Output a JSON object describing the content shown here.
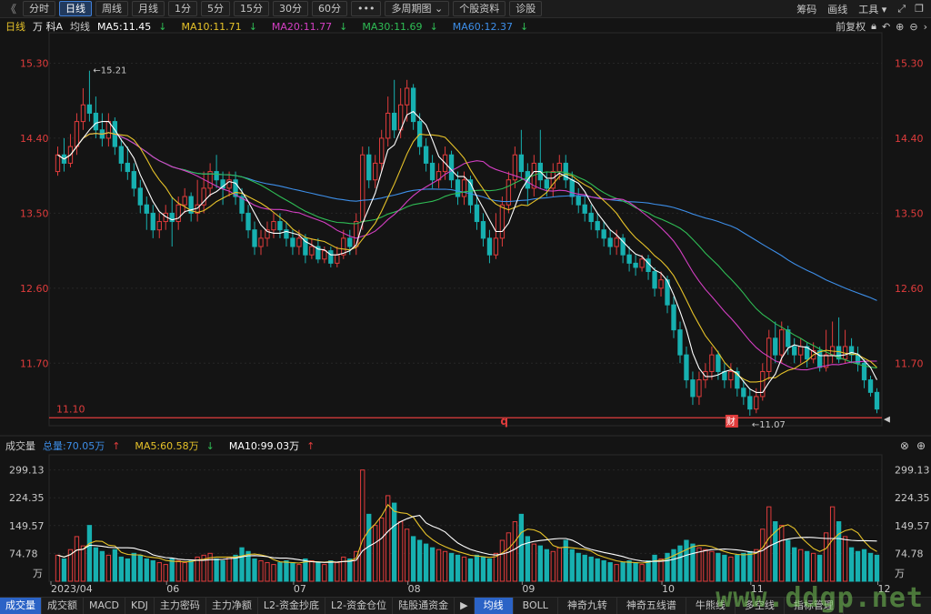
{
  "toolbar": {
    "back": "《",
    "periods": [
      "分时",
      "日线",
      "周线",
      "月线",
      "1分",
      "5分",
      "15分",
      "30分",
      "60分",
      "•••",
      "多周期图",
      "个股资料",
      "诊股"
    ],
    "active_period": "日线",
    "right_items": [
      "筹码",
      "画线",
      "工具"
    ]
  },
  "main_legend": {
    "period": "日线",
    "stock": "万 科A",
    "ma_label": "均线",
    "ma5": "MA5:11.45",
    "ma10": "MA10:11.71",
    "ma20": "MA20:11.77",
    "ma30": "MA30:11.69",
    "ma60": "MA60:12.37",
    "adjust": "前复权"
  },
  "vol_legend": {
    "label": "成交量",
    "total": "总量:70.05万",
    "ma5": "MA5:60.58万",
    "ma10": "MA10:99.03万"
  },
  "colors": {
    "up": "#e03c3c",
    "down": "#17b0b0",
    "ma5": "#ffffff",
    "ma10": "#e6c229",
    "ma20": "#d43fc3",
    "ma30": "#2fbd55",
    "ma60": "#3d8ee8"
  },
  "chart_data": {
    "type": "candlestick",
    "price_ticks": [
      "15.30",
      "14.40",
      "13.50",
      "12.60",
      "11.70"
    ],
    "price_ylim": [
      10.95,
      15.6
    ],
    "volume_ticks": [
      "299.13",
      "224.35",
      "149.57",
      "74.78"
    ],
    "volume_unit": "万",
    "volume_ylim": [
      0,
      330
    ],
    "x_labels": [
      "2023/04",
      "06",
      "07",
      "08",
      "09",
      "10",
      "11",
      "12"
    ],
    "high_annotation": "15.21",
    "low_annotation": "11.07",
    "hline_label": "11.10",
    "hline_value": 11.1,
    "markers": [
      "q",
      "财"
    ],
    "candles": [
      {
        "o": 14.0,
        "c": 14.2,
        "h": 14.3,
        "l": 13.95,
        "v": 70
      },
      {
        "o": 14.2,
        "c": 14.1,
        "h": 14.4,
        "l": 14.0,
        "v": 60
      },
      {
        "o": 14.1,
        "c": 14.3,
        "h": 14.45,
        "l": 14.05,
        "v": 85
      },
      {
        "o": 14.3,
        "c": 14.6,
        "h": 14.7,
        "l": 14.2,
        "v": 120
      },
      {
        "o": 14.6,
        "c": 14.8,
        "h": 15.0,
        "l": 14.5,
        "v": 95
      },
      {
        "o": 14.8,
        "c": 14.7,
        "h": 15.21,
        "l": 14.6,
        "v": 150
      },
      {
        "o": 14.7,
        "c": 14.5,
        "h": 14.9,
        "l": 14.4,
        "v": 90
      },
      {
        "o": 14.5,
        "c": 14.4,
        "h": 14.7,
        "l": 14.3,
        "v": 80
      },
      {
        "o": 14.4,
        "c": 14.6,
        "h": 14.7,
        "l": 14.3,
        "v": 70
      },
      {
        "o": 14.6,
        "c": 14.3,
        "h": 14.65,
        "l": 14.2,
        "v": 85
      },
      {
        "o": 14.3,
        "c": 14.1,
        "h": 14.4,
        "l": 14.0,
        "v": 65
      },
      {
        "o": 14.1,
        "c": 14.0,
        "h": 14.3,
        "l": 13.9,
        "v": 60
      },
      {
        "o": 14.0,
        "c": 13.8,
        "h": 14.1,
        "l": 13.7,
        "v": 75
      },
      {
        "o": 13.8,
        "c": 13.6,
        "h": 13.9,
        "l": 13.5,
        "v": 70
      },
      {
        "o": 13.6,
        "c": 13.5,
        "h": 13.7,
        "l": 13.3,
        "v": 60
      },
      {
        "o": 13.5,
        "c": 13.3,
        "h": 13.6,
        "l": 13.2,
        "v": 55
      },
      {
        "o": 13.3,
        "c": 13.4,
        "h": 13.5,
        "l": 13.2,
        "v": 50
      },
      {
        "o": 13.4,
        "c": 13.5,
        "h": 13.6,
        "l": 13.3,
        "v": 45
      },
      {
        "o": 13.5,
        "c": 13.4,
        "h": 13.7,
        "l": 13.1,
        "v": 60
      },
      {
        "o": 13.4,
        "c": 13.6,
        "h": 13.7,
        "l": 13.3,
        "v": 55
      },
      {
        "o": 13.6,
        "c": 13.7,
        "h": 13.8,
        "l": 13.5,
        "v": 50
      },
      {
        "o": 13.7,
        "c": 13.5,
        "h": 13.75,
        "l": 13.4,
        "v": 55
      },
      {
        "o": 13.5,
        "c": 13.6,
        "h": 13.9,
        "l": 13.4,
        "v": 65
      },
      {
        "o": 13.6,
        "c": 13.8,
        "h": 14.0,
        "l": 13.5,
        "v": 70
      },
      {
        "o": 13.8,
        "c": 14.0,
        "h": 14.1,
        "l": 13.7,
        "v": 75
      },
      {
        "o": 14.0,
        "c": 13.9,
        "h": 14.2,
        "l": 13.8,
        "v": 60
      },
      {
        "o": 13.9,
        "c": 13.8,
        "h": 14.0,
        "l": 13.6,
        "v": 55
      },
      {
        "o": 13.8,
        "c": 13.9,
        "h": 14.0,
        "l": 13.7,
        "v": 65
      },
      {
        "o": 13.9,
        "c": 13.7,
        "h": 14.0,
        "l": 13.6,
        "v": 70
      },
      {
        "o": 13.7,
        "c": 13.5,
        "h": 13.8,
        "l": 13.4,
        "v": 90
      },
      {
        "o": 13.5,
        "c": 13.3,
        "h": 13.6,
        "l": 13.2,
        "v": 80
      },
      {
        "o": 13.3,
        "c": 13.1,
        "h": 13.4,
        "l": 13.0,
        "v": 60
      },
      {
        "o": 13.1,
        "c": 13.2,
        "h": 13.3,
        "l": 13.0,
        "v": 55
      },
      {
        "o": 13.2,
        "c": 13.3,
        "h": 13.4,
        "l": 13.1,
        "v": 50
      },
      {
        "o": 13.3,
        "c": 13.4,
        "h": 13.5,
        "l": 13.2,
        "v": 45
      },
      {
        "o": 13.4,
        "c": 13.3,
        "h": 13.5,
        "l": 13.2,
        "v": 50
      },
      {
        "o": 13.3,
        "c": 13.2,
        "h": 13.4,
        "l": 13.1,
        "v": 55
      },
      {
        "o": 13.2,
        "c": 13.1,
        "h": 13.3,
        "l": 13.0,
        "v": 50
      },
      {
        "o": 13.1,
        "c": 13.2,
        "h": 13.3,
        "l": 13.0,
        "v": 45
      },
      {
        "o": 13.2,
        "c": 13.0,
        "h": 13.25,
        "l": 12.9,
        "v": 60
      },
      {
        "o": 13.0,
        "c": 13.1,
        "h": 13.2,
        "l": 12.95,
        "v": 55
      },
      {
        "o": 13.1,
        "c": 12.95,
        "h": 13.2,
        "l": 12.9,
        "v": 50
      },
      {
        "o": 12.95,
        "c": 13.05,
        "h": 13.1,
        "l": 12.9,
        "v": 45
      },
      {
        "o": 13.05,
        "c": 12.9,
        "h": 13.1,
        "l": 12.85,
        "v": 55
      },
      {
        "o": 12.9,
        "c": 13.0,
        "h": 13.1,
        "l": 12.85,
        "v": 50
      },
      {
        "o": 13.0,
        "c": 13.2,
        "h": 13.3,
        "l": 12.95,
        "v": 65
      },
      {
        "o": 13.2,
        "c": 13.1,
        "h": 13.3,
        "l": 13.0,
        "v": 60
      },
      {
        "o": 13.1,
        "c": 13.4,
        "h": 13.5,
        "l": 13.0,
        "v": 80
      },
      {
        "o": 13.4,
        "c": 14.2,
        "h": 14.3,
        "l": 13.3,
        "v": 299
      },
      {
        "o": 14.2,
        "c": 13.9,
        "h": 14.3,
        "l": 13.8,
        "v": 180
      },
      {
        "o": 13.9,
        "c": 14.1,
        "h": 14.2,
        "l": 13.8,
        "v": 150
      },
      {
        "o": 14.1,
        "c": 14.4,
        "h": 14.5,
        "l": 14.0,
        "v": 170
      },
      {
        "o": 14.4,
        "c": 14.7,
        "h": 14.9,
        "l": 14.3,
        "v": 230
      },
      {
        "o": 14.7,
        "c": 14.5,
        "h": 15.1,
        "l": 14.4,
        "v": 210
      },
      {
        "o": 14.5,
        "c": 14.8,
        "h": 15.0,
        "l": 14.4,
        "v": 160
      },
      {
        "o": 14.8,
        "c": 15.0,
        "h": 15.1,
        "l": 14.6,
        "v": 140
      },
      {
        "o": 15.0,
        "c": 14.6,
        "h": 15.05,
        "l": 14.5,
        "v": 120
      },
      {
        "o": 14.6,
        "c": 14.3,
        "h": 14.7,
        "l": 14.2,
        "v": 110
      },
      {
        "o": 14.3,
        "c": 14.1,
        "h": 14.4,
        "l": 14.0,
        "v": 100
      },
      {
        "o": 14.1,
        "c": 13.9,
        "h": 14.2,
        "l": 13.8,
        "v": 90
      },
      {
        "o": 13.9,
        "c": 14.0,
        "h": 14.1,
        "l": 13.8,
        "v": 85
      },
      {
        "o": 14.0,
        "c": 14.2,
        "h": 14.3,
        "l": 13.9,
        "v": 80
      },
      {
        "o": 14.2,
        "c": 13.9,
        "h": 14.25,
        "l": 13.8,
        "v": 75
      },
      {
        "o": 13.9,
        "c": 13.7,
        "h": 14.0,
        "l": 13.6,
        "v": 70
      },
      {
        "o": 13.7,
        "c": 13.9,
        "h": 14.0,
        "l": 13.6,
        "v": 65
      },
      {
        "o": 13.9,
        "c": 13.6,
        "h": 13.95,
        "l": 13.5,
        "v": 60
      },
      {
        "o": 13.6,
        "c": 13.4,
        "h": 13.7,
        "l": 13.3,
        "v": 70
      },
      {
        "o": 13.4,
        "c": 13.2,
        "h": 13.5,
        "l": 13.1,
        "v": 65
      },
      {
        "o": 13.2,
        "c": 13.0,
        "h": 13.3,
        "l": 12.9,
        "v": 60
      },
      {
        "o": 13.0,
        "c": 13.2,
        "h": 13.5,
        "l": 12.95,
        "v": 75
      },
      {
        "o": 13.2,
        "c": 13.6,
        "h": 13.7,
        "l": 13.1,
        "v": 110
      },
      {
        "o": 13.6,
        "c": 13.9,
        "h": 14.0,
        "l": 13.5,
        "v": 130
      },
      {
        "o": 13.9,
        "c": 14.2,
        "h": 14.3,
        "l": 13.8,
        "v": 160
      },
      {
        "o": 14.2,
        "c": 14.0,
        "h": 14.5,
        "l": 13.9,
        "v": 180
      },
      {
        "o": 14.0,
        "c": 13.8,
        "h": 14.1,
        "l": 13.6,
        "v": 120
      },
      {
        "o": 13.8,
        "c": 14.1,
        "h": 14.2,
        "l": 13.7,
        "v": 100
      },
      {
        "o": 14.1,
        "c": 13.9,
        "h": 14.5,
        "l": 13.8,
        "v": 95
      },
      {
        "o": 13.9,
        "c": 13.8,
        "h": 14.0,
        "l": 13.7,
        "v": 85
      },
      {
        "o": 13.8,
        "c": 14.0,
        "h": 14.1,
        "l": 13.7,
        "v": 80
      },
      {
        "o": 14.0,
        "c": 14.1,
        "h": 14.2,
        "l": 13.9,
        "v": 90
      },
      {
        "o": 14.1,
        "c": 13.9,
        "h": 14.2,
        "l": 13.8,
        "v": 110
      },
      {
        "o": 13.9,
        "c": 13.7,
        "h": 14.0,
        "l": 13.6,
        "v": 85
      },
      {
        "o": 13.7,
        "c": 13.6,
        "h": 13.8,
        "l": 13.5,
        "v": 75
      },
      {
        "o": 13.6,
        "c": 13.5,
        "h": 13.7,
        "l": 13.4,
        "v": 70
      },
      {
        "o": 13.5,
        "c": 13.4,
        "h": 13.6,
        "l": 13.3,
        "v": 65
      },
      {
        "o": 13.4,
        "c": 13.3,
        "h": 13.5,
        "l": 13.2,
        "v": 60
      },
      {
        "o": 13.3,
        "c": 13.2,
        "h": 13.4,
        "l": 13.1,
        "v": 55
      },
      {
        "o": 13.2,
        "c": 13.1,
        "h": 13.3,
        "l": 13.0,
        "v": 50
      },
      {
        "o": 13.1,
        "c": 13.2,
        "h": 13.3,
        "l": 13.0,
        "v": 45
      },
      {
        "o": 13.2,
        "c": 13.0,
        "h": 13.25,
        "l": 12.9,
        "v": 50
      },
      {
        "o": 13.0,
        "c": 12.9,
        "h": 13.1,
        "l": 12.8,
        "v": 55
      },
      {
        "o": 12.9,
        "c": 12.85,
        "h": 13.0,
        "l": 12.75,
        "v": 50
      },
      {
        "o": 12.85,
        "c": 12.95,
        "h": 13.0,
        "l": 12.8,
        "v": 45
      },
      {
        "o": 12.95,
        "c": 12.8,
        "h": 13.0,
        "l": 12.7,
        "v": 55
      },
      {
        "o": 12.8,
        "c": 12.6,
        "h": 12.85,
        "l": 12.5,
        "v": 70
      },
      {
        "o": 12.6,
        "c": 12.7,
        "h": 12.8,
        "l": 12.5,
        "v": 60
      },
      {
        "o": 12.7,
        "c": 12.4,
        "h": 12.75,
        "l": 12.3,
        "v": 75
      },
      {
        "o": 12.4,
        "c": 12.1,
        "h": 12.5,
        "l": 12.0,
        "v": 85
      },
      {
        "o": 12.1,
        "c": 11.8,
        "h": 12.2,
        "l": 11.7,
        "v": 95
      },
      {
        "o": 11.8,
        "c": 11.5,
        "h": 11.9,
        "l": 11.4,
        "v": 110
      },
      {
        "o": 11.5,
        "c": 11.3,
        "h": 11.6,
        "l": 11.2,
        "v": 100
      },
      {
        "o": 11.3,
        "c": 11.5,
        "h": 11.6,
        "l": 11.2,
        "v": 90
      },
      {
        "o": 11.5,
        "c": 11.6,
        "h": 11.7,
        "l": 11.4,
        "v": 85
      },
      {
        "o": 11.6,
        "c": 11.8,
        "h": 11.9,
        "l": 11.5,
        "v": 80
      },
      {
        "o": 11.8,
        "c": 11.6,
        "h": 11.85,
        "l": 11.5,
        "v": 75
      },
      {
        "o": 11.6,
        "c": 11.5,
        "h": 11.7,
        "l": 11.4,
        "v": 70
      },
      {
        "o": 11.5,
        "c": 11.6,
        "h": 11.7,
        "l": 11.4,
        "v": 65
      },
      {
        "o": 11.6,
        "c": 11.4,
        "h": 11.65,
        "l": 11.3,
        "v": 70
      },
      {
        "o": 11.4,
        "c": 11.3,
        "h": 11.5,
        "l": 11.2,
        "v": 75
      },
      {
        "o": 11.3,
        "c": 11.15,
        "h": 11.4,
        "l": 11.07,
        "v": 80
      },
      {
        "o": 11.15,
        "c": 11.3,
        "h": 11.4,
        "l": 11.1,
        "v": 85
      },
      {
        "o": 11.3,
        "c": 11.6,
        "h": 11.7,
        "l": 11.25,
        "v": 140
      },
      {
        "o": 11.6,
        "c": 12.0,
        "h": 12.1,
        "l": 11.5,
        "v": 200
      },
      {
        "o": 12.0,
        "c": 11.8,
        "h": 12.2,
        "l": 11.7,
        "v": 160
      },
      {
        "o": 11.8,
        "c": 12.1,
        "h": 12.2,
        "l": 11.7,
        "v": 150
      },
      {
        "o": 12.1,
        "c": 11.9,
        "h": 12.15,
        "l": 11.8,
        "v": 110
      },
      {
        "o": 11.9,
        "c": 11.8,
        "h": 12.0,
        "l": 11.7,
        "v": 90
      },
      {
        "o": 11.8,
        "c": 11.9,
        "h": 12.0,
        "l": 11.7,
        "v": 85
      },
      {
        "o": 11.9,
        "c": 11.75,
        "h": 11.95,
        "l": 11.65,
        "v": 80
      },
      {
        "o": 11.75,
        "c": 11.85,
        "h": 11.95,
        "l": 11.7,
        "v": 75
      },
      {
        "o": 11.85,
        "c": 11.65,
        "h": 11.9,
        "l": 11.6,
        "v": 70
      },
      {
        "o": 11.65,
        "c": 11.8,
        "h": 12.1,
        "l": 11.6,
        "v": 130
      },
      {
        "o": 11.8,
        "c": 11.9,
        "h": 12.2,
        "l": 11.7,
        "v": 200
      },
      {
        "o": 11.9,
        "c": 11.75,
        "h": 12.25,
        "l": 11.7,
        "v": 160
      },
      {
        "o": 11.75,
        "c": 11.9,
        "h": 12.1,
        "l": 11.7,
        "v": 120
      },
      {
        "o": 11.9,
        "c": 11.8,
        "h": 12.0,
        "l": 11.7,
        "v": 90
      },
      {
        "o": 11.8,
        "c": 11.7,
        "h": 11.9,
        "l": 11.6,
        "v": 80
      },
      {
        "o": 11.7,
        "c": 11.5,
        "h": 11.75,
        "l": 11.4,
        "v": 85
      },
      {
        "o": 11.5,
        "c": 11.35,
        "h": 11.55,
        "l": 11.3,
        "v": 75
      },
      {
        "o": 11.35,
        "c": 11.15,
        "h": 11.4,
        "l": 11.1,
        "v": 70
      }
    ]
  },
  "vol_icons": [
    "close-icon",
    "plus-icon"
  ],
  "bottom_tabs_left": [
    "成交量",
    "成交额",
    "MACD",
    "KDJ",
    "主力密码",
    "主力净额",
    "L2-资金抄底",
    "L2-资金仓位",
    "陆股通资金"
  ],
  "bottom_tabs_right": [
    "均线",
    "BOLL",
    "神奇九转",
    "神奇五线谱",
    "牛熊线",
    "多空线",
    "指标管理"
  ],
  "watermark": "www.ddgp.net"
}
